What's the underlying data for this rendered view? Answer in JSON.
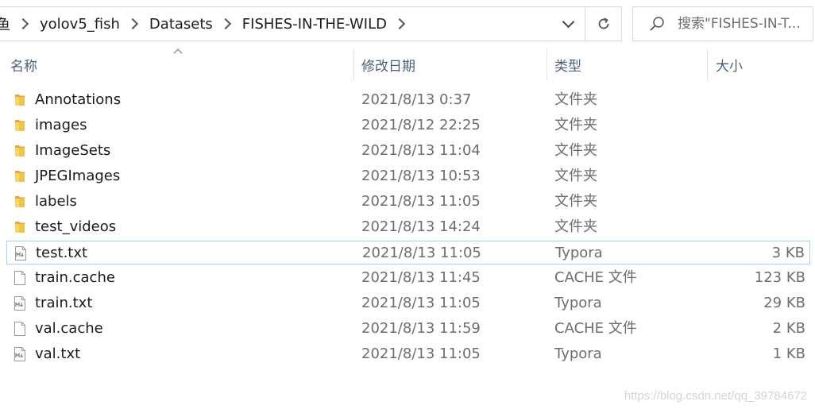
{
  "address_bar": {
    "crumbs": [
      "鱼",
      "yolov5_fish",
      "Datasets",
      "FISHES-IN-THE-WILD"
    ]
  },
  "search": {
    "placeholder": "搜索\"FISHES-IN-T..."
  },
  "columns": {
    "name": "名称",
    "date": "修改日期",
    "type": "类型",
    "size": "大小"
  },
  "files": [
    {
      "name": "Annotations",
      "date": "2021/8/13 0:37",
      "type": "文件夹",
      "size": "",
      "icon": "folder-icon"
    },
    {
      "name": "images",
      "date": "2021/8/12 22:25",
      "type": "文件夹",
      "size": "",
      "icon": "folder-icon"
    },
    {
      "name": "ImageSets",
      "date": "2021/8/13 11:04",
      "type": "文件夹",
      "size": "",
      "icon": "folder-icon"
    },
    {
      "name": "JPEGImages",
      "date": "2021/8/13 10:53",
      "type": "文件夹",
      "size": "",
      "icon": "folder-icon"
    },
    {
      "name": "labels",
      "date": "2021/8/13 11:05",
      "type": "文件夹",
      "size": "",
      "icon": "folder-icon"
    },
    {
      "name": "test_videos",
      "date": "2021/8/13 14:24",
      "type": "文件夹",
      "size": "",
      "icon": "folder-icon"
    },
    {
      "name": "test.txt",
      "date": "2021/8/13 11:05",
      "type": "Typora",
      "size": "3 KB",
      "icon": "markdown-file-icon",
      "selected": true
    },
    {
      "name": "train.cache",
      "date": "2021/8/13 11:45",
      "type": "CACHE 文件",
      "size": "123 KB",
      "icon": "blank-file-icon"
    },
    {
      "name": "train.txt",
      "date": "2021/8/13 11:05",
      "type": "Typora",
      "size": "29 KB",
      "icon": "markdown-file-icon"
    },
    {
      "name": "val.cache",
      "date": "2021/8/13 11:59",
      "type": "CACHE 文件",
      "size": "2 KB",
      "icon": "blank-file-icon"
    },
    {
      "name": "val.txt",
      "date": "2021/8/13 11:05",
      "type": "Typora",
      "size": "1 KB",
      "icon": "markdown-file-icon"
    }
  ],
  "watermark": "https://blog.csdn.net/qq_39784672",
  "colors": {
    "folder": "#f0c540",
    "selection_border": "#99d1ff",
    "header_text": "#4c607a"
  }
}
